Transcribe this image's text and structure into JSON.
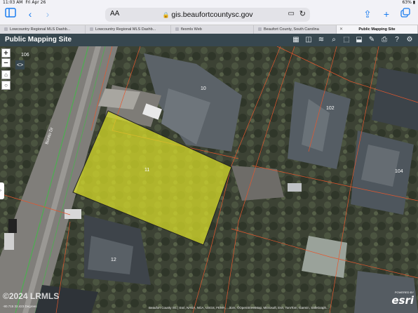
{
  "status_bar": {
    "time": "11:03 AM",
    "date": "Fri Apr 26",
    "battery": "63%"
  },
  "browser": {
    "reader_label": "AA",
    "url": "gis.beaufortcountysc.gov",
    "tabs": [
      {
        "label": "Lowcountry Regional MLS Dashb..."
      },
      {
        "label": "Lowcountry Regional MLS Dashb..."
      },
      {
        "label": "flexmls Web"
      },
      {
        "label": "Beaufort County, South Carolina"
      },
      {
        "label": "Public Mapping Site",
        "active": true
      }
    ],
    "icons": [
      "sidebar-icon",
      "back-icon",
      "forward-icon",
      "share-icon",
      "new-tab-icon",
      "tab-overview-icon"
    ]
  },
  "app": {
    "title": "Public Mapping Site"
  },
  "toolbar": {
    "tools": [
      "identify-icon",
      "basemap-icon",
      "layers-icon",
      "search-icon",
      "measure-icon",
      "select-icon",
      "draw-icon",
      "print-icon",
      "help-icon",
      "settings-icon"
    ]
  },
  "map": {
    "zoom_in": "+",
    "zoom_out": "−",
    "scale_label": "<>",
    "street_label": "Bonito Dr",
    "parcels": [
      "10",
      "11",
      "12",
      "102",
      "104",
      "106"
    ],
    "coordinates": "-80.715 32.423 Degrees",
    "attribution": "Beaufort County SC | Esri, NASA, NGA, USGS, FEMA, ...itors, ©OpenStreetMap, Microsoft, Esri, TomTom, Garmin, SafeGraph...",
    "powered_by": "POWERED BY",
    "esri_logo": "esri",
    "watermark": "©2024 LRMLS"
  }
}
